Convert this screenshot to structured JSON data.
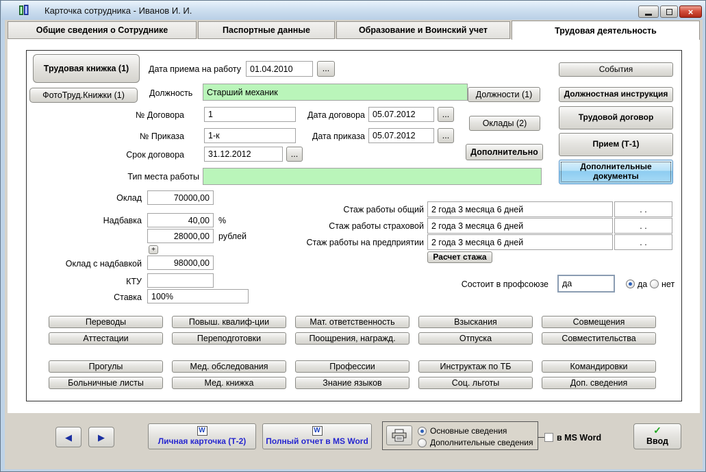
{
  "window": {
    "title": "Карточка сотрудника -  Иванов И. И."
  },
  "icons": {
    "app": "books-icon",
    "close": "×",
    "nav_left": "◀",
    "nav_right": "▶",
    "check": "✓",
    "word": "W"
  },
  "tabs": {
    "general": "Общие сведения о Сотруднике",
    "passport": "Паспортные данные",
    "education": "Образование и Воинский учет",
    "labor": "Трудовая деятельность"
  },
  "left_panel": {
    "work_book": "Трудовая книжка (1)",
    "photo_books": "ФотоТруд.Книжки (1)"
  },
  "form": {
    "hire_date_label": "Дата приема на работу",
    "hire_date": "01.04.2010",
    "browse": "...",
    "position_label": "Должность",
    "position": "Старший механик",
    "positions_button": "Должности (1)",
    "contract_no_label": "№ Договора",
    "contract_no": "1",
    "contract_date_label": "Дата договора",
    "contract_date": "05.07.2012",
    "order_no_label": "№ Приказа",
    "order_no": "1-к",
    "order_date_label": "Дата приказа",
    "order_date": "05.07.2012",
    "salaries_button": "Оклады (2)",
    "contract_term_label": "Срок договора",
    "contract_term": "31.12.2012",
    "additional_button": "Дополнительно",
    "workplace_type_label": "Тип места работы",
    "workplace_type": ""
  },
  "salary": {
    "salary_label": "Оклад",
    "salary": "70000,00",
    "bonus_label": "Надбавка",
    "bonus_percent": "40,00",
    "percent_sign": "%",
    "bonus_rub": "28000,00",
    "rub_label": "рублей",
    "plus_button": "+",
    "total_label": "Оклад с надбавкой",
    "total": "98000,00",
    "ktu_label": "КТУ",
    "ktu": "",
    "rate_label": "Ставка",
    "rate": "100%"
  },
  "seniority": {
    "rows": [
      {
        "label": "Стаж работы общий",
        "value": "2 года 3 месяца 6 дней",
        "date": ". ."
      },
      {
        "label": "Стаж работы страховой",
        "value": "2 года 3 месяца 6 дней",
        "date": ". ."
      },
      {
        "label": "Стаж работы на предприятии",
        "value": "2 года 3 месяца 6 дней",
        "date": ". ."
      }
    ],
    "calc_button": "Расчет стажа"
  },
  "union": {
    "label": "Состоит в профсоюзе",
    "value": "да",
    "yes_label": "да",
    "no_label": "нет"
  },
  "side_buttons": {
    "events": "События",
    "job_instruction": "Должностная инструкция",
    "labor_contract": "Трудовой договор",
    "hire_t1": "Прием (Т-1)",
    "additional_docs": "Дополнительные документы"
  },
  "grid_buttons": [
    "Переводы",
    "Повыш. квалиф-ции",
    "Мат. ответственность",
    "Взыскания",
    "Совмещения",
    "Аттестации",
    "Переподготовки",
    "Поощрения, награжд.",
    "Отпуска",
    "Совместительства",
    "Прогулы",
    "Мед. обследования",
    "Профессии",
    "Инструктаж по ТБ",
    "Командировки",
    "Больничные листы",
    "Мед. книжка",
    "Знание языков",
    "Соц. льготы",
    "Доп. сведения"
  ],
  "bottom": {
    "personal_card": "Личная карточка (Т-2)",
    "full_report": "Полный отчет в MS Word",
    "radio_main": "Основные сведения",
    "radio_additional": "Дополнительные сведения",
    "in_word": "в MS Word",
    "enter": "Ввод"
  },
  "colors": {
    "green_field": "#baf5ba",
    "focus_button_blue": "#8dccf1",
    "link_text_blue": "#2626cf",
    "check_green": "#1fa51f",
    "close_red": "#c23a28",
    "nav_arrow_blue": "#1b2fa0",
    "titlebar_blue": "#cfe0f0",
    "client_gray": "#d6d2c9"
  }
}
